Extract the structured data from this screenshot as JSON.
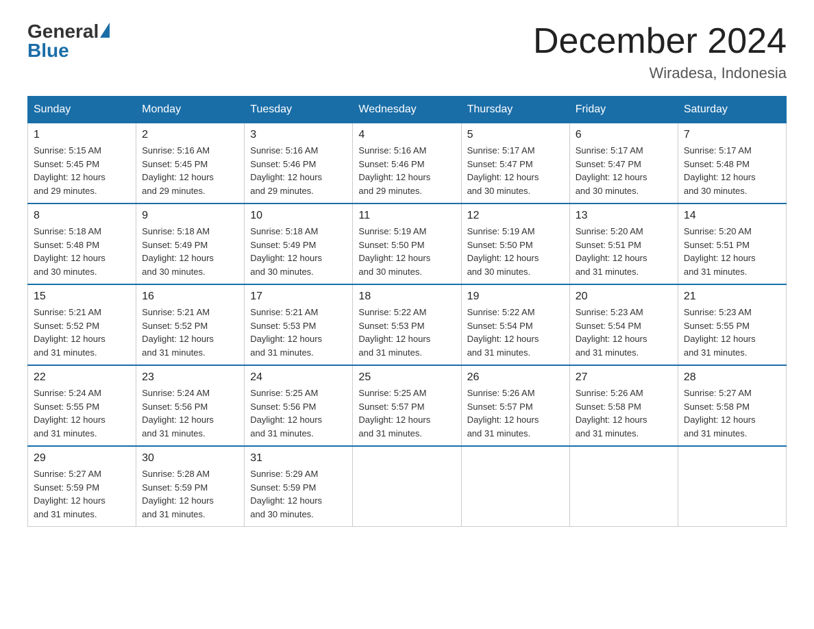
{
  "logo": {
    "general": "General",
    "blue": "Blue"
  },
  "title": "December 2024",
  "location": "Wiradesa, Indonesia",
  "days_header": [
    "Sunday",
    "Monday",
    "Tuesday",
    "Wednesday",
    "Thursday",
    "Friday",
    "Saturday"
  ],
  "weeks": [
    [
      {
        "day": "1",
        "sunrise": "5:15 AM",
        "sunset": "5:45 PM",
        "daylight": "12 hours and 29 minutes."
      },
      {
        "day": "2",
        "sunrise": "5:16 AM",
        "sunset": "5:45 PM",
        "daylight": "12 hours and 29 minutes."
      },
      {
        "day": "3",
        "sunrise": "5:16 AM",
        "sunset": "5:46 PM",
        "daylight": "12 hours and 29 minutes."
      },
      {
        "day": "4",
        "sunrise": "5:16 AM",
        "sunset": "5:46 PM",
        "daylight": "12 hours and 29 minutes."
      },
      {
        "day": "5",
        "sunrise": "5:17 AM",
        "sunset": "5:47 PM",
        "daylight": "12 hours and 30 minutes."
      },
      {
        "day": "6",
        "sunrise": "5:17 AM",
        "sunset": "5:47 PM",
        "daylight": "12 hours and 30 minutes."
      },
      {
        "day": "7",
        "sunrise": "5:17 AM",
        "sunset": "5:48 PM",
        "daylight": "12 hours and 30 minutes."
      }
    ],
    [
      {
        "day": "8",
        "sunrise": "5:18 AM",
        "sunset": "5:48 PM",
        "daylight": "12 hours and 30 minutes."
      },
      {
        "day": "9",
        "sunrise": "5:18 AM",
        "sunset": "5:49 PM",
        "daylight": "12 hours and 30 minutes."
      },
      {
        "day": "10",
        "sunrise": "5:18 AM",
        "sunset": "5:49 PM",
        "daylight": "12 hours and 30 minutes."
      },
      {
        "day": "11",
        "sunrise": "5:19 AM",
        "sunset": "5:50 PM",
        "daylight": "12 hours and 30 minutes."
      },
      {
        "day": "12",
        "sunrise": "5:19 AM",
        "sunset": "5:50 PM",
        "daylight": "12 hours and 30 minutes."
      },
      {
        "day": "13",
        "sunrise": "5:20 AM",
        "sunset": "5:51 PM",
        "daylight": "12 hours and 31 minutes."
      },
      {
        "day": "14",
        "sunrise": "5:20 AM",
        "sunset": "5:51 PM",
        "daylight": "12 hours and 31 minutes."
      }
    ],
    [
      {
        "day": "15",
        "sunrise": "5:21 AM",
        "sunset": "5:52 PM",
        "daylight": "12 hours and 31 minutes."
      },
      {
        "day": "16",
        "sunrise": "5:21 AM",
        "sunset": "5:52 PM",
        "daylight": "12 hours and 31 minutes."
      },
      {
        "day": "17",
        "sunrise": "5:21 AM",
        "sunset": "5:53 PM",
        "daylight": "12 hours and 31 minutes."
      },
      {
        "day": "18",
        "sunrise": "5:22 AM",
        "sunset": "5:53 PM",
        "daylight": "12 hours and 31 minutes."
      },
      {
        "day": "19",
        "sunrise": "5:22 AM",
        "sunset": "5:54 PM",
        "daylight": "12 hours and 31 minutes."
      },
      {
        "day": "20",
        "sunrise": "5:23 AM",
        "sunset": "5:54 PM",
        "daylight": "12 hours and 31 minutes."
      },
      {
        "day": "21",
        "sunrise": "5:23 AM",
        "sunset": "5:55 PM",
        "daylight": "12 hours and 31 minutes."
      }
    ],
    [
      {
        "day": "22",
        "sunrise": "5:24 AM",
        "sunset": "5:55 PM",
        "daylight": "12 hours and 31 minutes."
      },
      {
        "day": "23",
        "sunrise": "5:24 AM",
        "sunset": "5:56 PM",
        "daylight": "12 hours and 31 minutes."
      },
      {
        "day": "24",
        "sunrise": "5:25 AM",
        "sunset": "5:56 PM",
        "daylight": "12 hours and 31 minutes."
      },
      {
        "day": "25",
        "sunrise": "5:25 AM",
        "sunset": "5:57 PM",
        "daylight": "12 hours and 31 minutes."
      },
      {
        "day": "26",
        "sunrise": "5:26 AM",
        "sunset": "5:57 PM",
        "daylight": "12 hours and 31 minutes."
      },
      {
        "day": "27",
        "sunrise": "5:26 AM",
        "sunset": "5:58 PM",
        "daylight": "12 hours and 31 minutes."
      },
      {
        "day": "28",
        "sunrise": "5:27 AM",
        "sunset": "5:58 PM",
        "daylight": "12 hours and 31 minutes."
      }
    ],
    [
      {
        "day": "29",
        "sunrise": "5:27 AM",
        "sunset": "5:59 PM",
        "daylight": "12 hours and 31 minutes."
      },
      {
        "day": "30",
        "sunrise": "5:28 AM",
        "sunset": "5:59 PM",
        "daylight": "12 hours and 31 minutes."
      },
      {
        "day": "31",
        "sunrise": "5:29 AM",
        "sunset": "5:59 PM",
        "daylight": "12 hours and 30 minutes."
      },
      null,
      null,
      null,
      null
    ]
  ],
  "labels": {
    "sunrise": "Sunrise:",
    "sunset": "Sunset:",
    "daylight": "Daylight:"
  }
}
